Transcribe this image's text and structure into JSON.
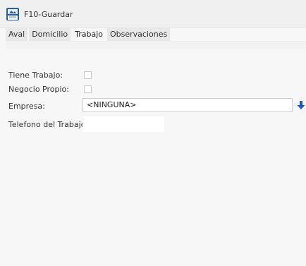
{
  "toolbar": {
    "save": {
      "label": "F10-Guardar",
      "icon": "save-icon"
    }
  },
  "tabs": [
    {
      "label": "Aval",
      "active": false
    },
    {
      "label": "Domicilio",
      "active": false
    },
    {
      "label": "Trabajo",
      "active": true
    },
    {
      "label": "Observaciones",
      "active": false
    }
  ],
  "form": {
    "tiene_trabajo": {
      "label": "Tiene Trabajo:",
      "checked": false
    },
    "negocio_propio": {
      "label": "Negocio Propio:",
      "checked": false
    },
    "empresa": {
      "label": "Empresa:",
      "value": "<NINGUNA>",
      "button_icon": "arrow-down-icon"
    },
    "telefono": {
      "label": "Telefono del Trabajo:",
      "value": ""
    }
  },
  "colors": {
    "accent_blue": "#1e56d6"
  }
}
